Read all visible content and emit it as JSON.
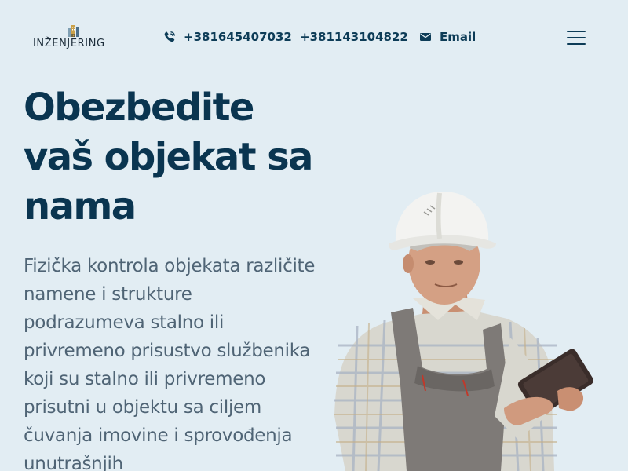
{
  "header": {
    "logo": {
      "mark": "IB",
      "text": "INŽENJERING"
    },
    "phones": [
      "+381645407032",
      "+381143104822"
    ],
    "email_label": "Email",
    "icons": {
      "phone": "phone-icon",
      "email": "envelope-icon",
      "menu": "hamburger-menu-icon"
    }
  },
  "hero": {
    "title": "Obezbedite vaš objekat sa nama",
    "text": "Fizička kontrola objekata različite namene i strukture podrazumeva stalno ili privremeno prisustvo službenika koji su stalno ili privremeno prisutni u objektu sa ciljem čuvanja imovine i sprovođenja unutrašnjih"
  },
  "colors": {
    "background": "#e2edf3",
    "heading": "#0a3550",
    "body_text": "#4f6475",
    "accent": "#0d3c57"
  }
}
